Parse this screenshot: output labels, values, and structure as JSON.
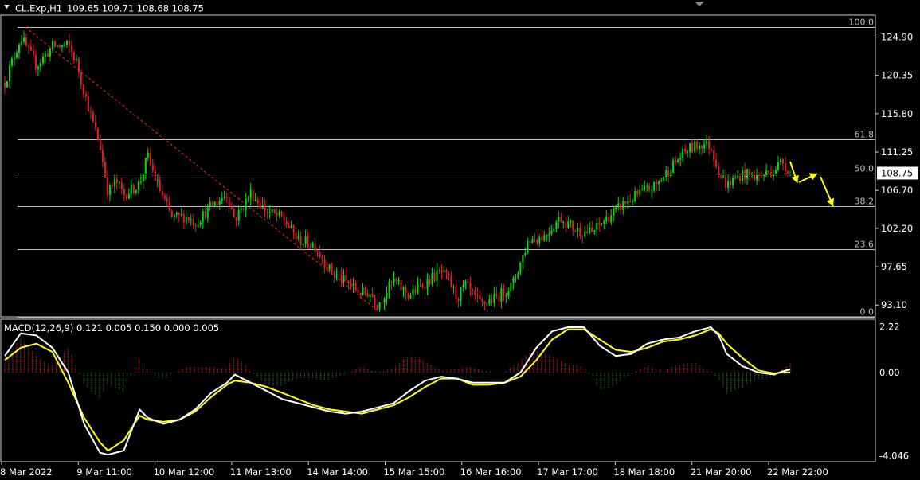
{
  "header": {
    "symbol": "CL.Exp,H1",
    "ohlc": "109.65 109.71 108.68 108.75"
  },
  "colors": {
    "background": "#000000",
    "foreground": "#ffffff",
    "bull": "#00e000",
    "bear": "#e02020",
    "grid_line": "#bfbfbf",
    "trend": "#ff2020",
    "signal_arrow": "#ffff00",
    "macd_line": "#ffffff",
    "signal_line": "#ffff00",
    "hist_positive": "#b02020",
    "hist_negative": "#1e6a1e"
  },
  "chart_data": [
    {
      "type": "candlestick",
      "title": "CL.Exp,H1",
      "price_axis": {
        "ylim": [
          91.8,
          127.4
        ],
        "ticks": [
          "124.90",
          "120.35",
          "115.80",
          "111.25",
          "106.70",
          "102.20",
          "97.65",
          "93.10"
        ],
        "current_price": "108.75"
      },
      "time_axis": {
        "labels": [
          "8 Mar 2022",
          "9 Mar 11:00",
          "10 Mar 12:00",
          "11 Mar 13:00",
          "14 Mar 14:00",
          "15 Mar 15:00",
          "16 Mar 16:00",
          "17 Mar 17:00",
          "18 Mar 18:00",
          "21 Mar 20:00",
          "22 Mar 22:00"
        ]
      },
      "fibonacci_levels": [
        {
          "label": "100.0",
          "price": 126.05
        },
        {
          "label": "61.8",
          "price": 112.8
        },
        {
          "label": "50.0",
          "price": 108.75
        },
        {
          "label": "38.2",
          "price": 104.8
        },
        {
          "label": "23.6",
          "price": 99.75
        },
        {
          "label": "0.0",
          "price": 91.7
        }
      ],
      "trendline": {
        "from": [
          "8 Mar 2022",
          126.05
        ],
        "to": [
          "15 Mar 15:00",
          92.5
        ]
      },
      "arrows": [
        "down",
        "up",
        "down"
      ],
      "close_path": [
        [
          0,
          119.5
        ],
        [
          2,
          124.9
        ],
        [
          4,
          121.5
        ],
        [
          6,
          123.8
        ],
        [
          8,
          123.9
        ],
        [
          9,
          122.0
        ],
        [
          11,
          115.0
        ],
        [
          12,
          112.0
        ],
        [
          13,
          106.5
        ],
        [
          14,
          107.8
        ],
        [
          15,
          106.2
        ],
        [
          17,
          107.5
        ],
        [
          18,
          110.8
        ],
        [
          19,
          108.0
        ],
        [
          21,
          103.5
        ],
        [
          23,
          103.6
        ],
        [
          24,
          102.8
        ],
        [
          26,
          104.8
        ],
        [
          28,
          106.3
        ],
        [
          29,
          103.2
        ],
        [
          31,
          106.4
        ],
        [
          33,
          104.2
        ],
        [
          35,
          103.4
        ],
        [
          37,
          100.8
        ],
        [
          39,
          100.3
        ],
        [
          41,
          97.2
        ],
        [
          43,
          95.8
        ],
        [
          45,
          94.5
        ],
        [
          46,
          94.6
        ],
        [
          47,
          93.2
        ],
        [
          49,
          96.0
        ],
        [
          51,
          94.2
        ],
        [
          53,
          95.8
        ],
        [
          55,
          97.0
        ],
        [
          56,
          96.0
        ],
        [
          57,
          93.9
        ],
        [
          58,
          95.5
        ],
        [
          60,
          93.1
        ],
        [
          62,
          94.0
        ],
        [
          64,
          95.5
        ],
        [
          66,
          100.8
        ],
        [
          68,
          101.3
        ],
        [
          70,
          103.5
        ],
        [
          72,
          102.0
        ],
        [
          74,
          101.7
        ],
        [
          76,
          103.5
        ],
        [
          78,
          105.1
        ],
        [
          80,
          106.3
        ],
        [
          82,
          107.2
        ],
        [
          84,
          109.5
        ],
        [
          86,
          111.5
        ],
        [
          88,
          112.3
        ],
        [
          89,
          111.9
        ],
        [
          90,
          109.0
        ],
        [
          91,
          107.3
        ],
        [
          93,
          108.7
        ],
        [
          95,
          108.3
        ],
        [
          97,
          109.2
        ],
        [
          98,
          110.2
        ],
        [
          99,
          108.75
        ]
      ]
    },
    {
      "type": "line",
      "title": "MACD(12,26,9) 0.121 0.005 0.150 0.000 0.005",
      "ylim": [
        -4.3,
        2.55
      ],
      "ticks": [
        "2.22",
        "0.00",
        "-4.046"
      ],
      "series": [
        {
          "name": "MACD",
          "points": [
            [
              0,
              0.8
            ],
            [
              2,
              1.9
            ],
            [
              4,
              1.8
            ],
            [
              6,
              1.2
            ],
            [
              8,
              0.0
            ],
            [
              10,
              -2.5
            ],
            [
              12,
              -3.9
            ],
            [
              13,
              -4.0
            ],
            [
              15,
              -3.8
            ],
            [
              17,
              -1.8
            ],
            [
              18,
              -2.2
            ],
            [
              20,
              -2.5
            ],
            [
              22,
              -2.3
            ],
            [
              24,
              -1.8
            ],
            [
              26,
              -1.0
            ],
            [
              28,
              -0.5
            ],
            [
              29,
              -0.1
            ],
            [
              31,
              -0.5
            ],
            [
              33,
              -0.9
            ],
            [
              35,
              -1.3
            ],
            [
              37,
              -1.5
            ],
            [
              39,
              -1.7
            ],
            [
              41,
              -1.9
            ],
            [
              43,
              -2.0
            ],
            [
              45,
              -1.9
            ],
            [
              47,
              -1.7
            ],
            [
              49,
              -1.5
            ],
            [
              51,
              -0.9
            ],
            [
              53,
              -0.4
            ],
            [
              55,
              -0.2
            ],
            [
              57,
              -0.3
            ],
            [
              59,
              -0.5
            ],
            [
              61,
              -0.5
            ],
            [
              63,
              -0.5
            ],
            [
              65,
              0.0
            ],
            [
              67,
              1.2
            ],
            [
              69,
              2.0
            ],
            [
              71,
              2.2
            ],
            [
              73,
              2.2
            ],
            [
              75,
              1.3
            ],
            [
              77,
              0.8
            ],
            [
              79,
              0.9
            ],
            [
              81,
              1.4
            ],
            [
              83,
              1.6
            ],
            [
              85,
              1.7
            ],
            [
              87,
              2.0
            ],
            [
              89,
              2.2
            ],
            [
              90,
              1.8
            ],
            [
              91,
              0.9
            ],
            [
              93,
              0.3
            ],
            [
              95,
              0.0
            ],
            [
              97,
              -0.1
            ],
            [
              98,
              0.05
            ],
            [
              99,
              0.15
            ]
          ]
        },
        {
          "name": "Signal",
          "points": [
            [
              0,
              0.6
            ],
            [
              2,
              1.2
            ],
            [
              4,
              1.4
            ],
            [
              6,
              1.0
            ],
            [
              8,
              -0.5
            ],
            [
              10,
              -2.2
            ],
            [
              12,
              -3.4
            ],
            [
              13,
              -3.8
            ],
            [
              15,
              -3.3
            ],
            [
              17,
              -2.1
            ],
            [
              18,
              -2.3
            ],
            [
              20,
              -2.4
            ],
            [
              22,
              -2.3
            ],
            [
              24,
              -1.9
            ],
            [
              26,
              -1.2
            ],
            [
              28,
              -0.6
            ],
            [
              29,
              -0.4
            ],
            [
              31,
              -0.5
            ],
            [
              33,
              -0.7
            ],
            [
              35,
              -1.0
            ],
            [
              37,
              -1.3
            ],
            [
              39,
              -1.6
            ],
            [
              41,
              -1.8
            ],
            [
              43,
              -1.9
            ],
            [
              45,
              -2.0
            ],
            [
              47,
              -1.8
            ],
            [
              49,
              -1.6
            ],
            [
              51,
              -1.2
            ],
            [
              53,
              -0.7
            ],
            [
              55,
              -0.3
            ],
            [
              57,
              -0.3
            ],
            [
              59,
              -0.6
            ],
            [
              61,
              -0.6
            ],
            [
              63,
              -0.5
            ],
            [
              65,
              -0.2
            ],
            [
              67,
              0.6
            ],
            [
              69,
              1.6
            ],
            [
              71,
              2.1
            ],
            [
              73,
              2.1
            ],
            [
              75,
              1.6
            ],
            [
              77,
              1.1
            ],
            [
              79,
              1.0
            ],
            [
              81,
              1.2
            ],
            [
              83,
              1.5
            ],
            [
              85,
              1.6
            ],
            [
              87,
              1.8
            ],
            [
              89,
              2.1
            ],
            [
              90,
              1.9
            ],
            [
              91,
              1.4
            ],
            [
              93,
              0.7
            ],
            [
              95,
              0.1
            ],
            [
              97,
              -0.05
            ],
            [
              98,
              0.0
            ],
            [
              99,
              0.005
            ]
          ]
        }
      ]
    }
  ]
}
